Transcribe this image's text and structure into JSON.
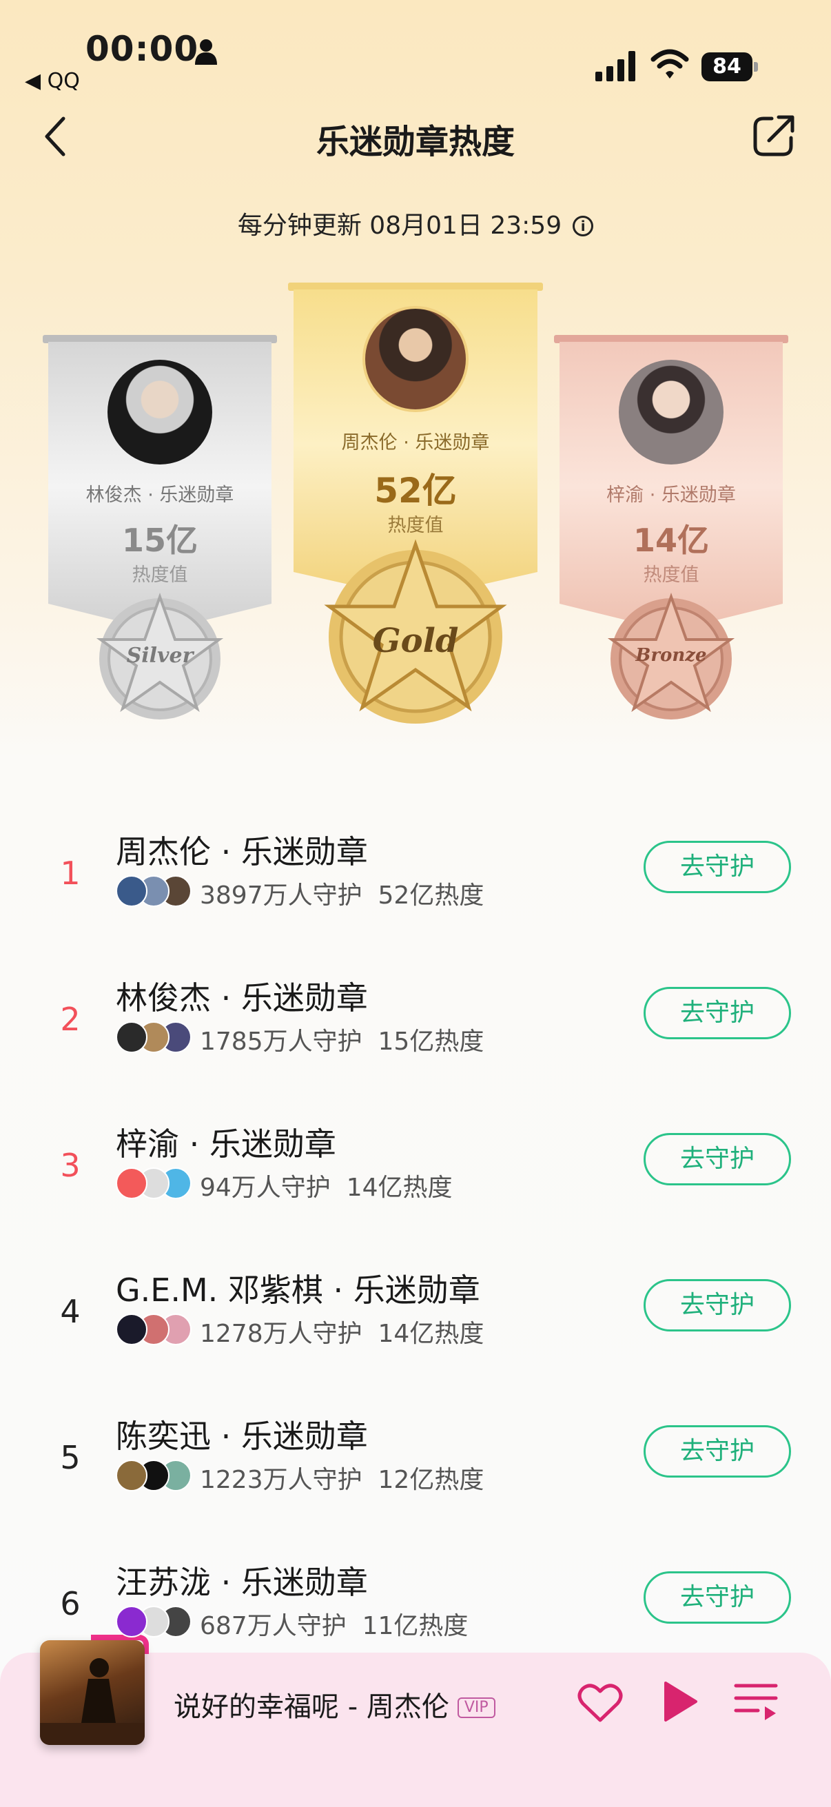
{
  "status_bar": {
    "time": "00:00",
    "back_app": "◀ QQ",
    "battery": "84"
  },
  "nav": {
    "title": "乐迷勋章热度"
  },
  "update": {
    "text": "每分钟更新 08月01日 23:59",
    "info_glyph": "i"
  },
  "podium": {
    "gold": {
      "name": "周杰伦 · 乐迷勋章",
      "value": "52亿",
      "sub": "热度值",
      "medal": "Gold"
    },
    "silver": {
      "name": "林俊杰 · 乐迷勋章",
      "value": "15亿",
      "sub": "热度值",
      "medal": "Silver"
    },
    "bronze": {
      "name": "梓渝 · 乐迷勋章",
      "value": "14亿",
      "sub": "热度值",
      "medal": "Bronze"
    }
  },
  "rankings": [
    {
      "rank": "1",
      "title": "周杰伦 · 乐迷勋章",
      "stats": "3897万人守护  52亿热度",
      "button": "去守护",
      "avatar_colors": [
        "#3a5a8a",
        "#7a8fb0",
        "#5a4636"
      ]
    },
    {
      "rank": "2",
      "title": "林俊杰 · 乐迷勋章",
      "stats": "1785万人守护  15亿热度",
      "button": "去守护",
      "avatar_colors": [
        "#2a2a2a",
        "#b08a5a",
        "#4a4a7a"
      ]
    },
    {
      "rank": "3",
      "title": "梓渝 · 乐迷勋章",
      "stats": "94万人守护  14亿热度",
      "button": "去守护",
      "avatar_colors": [
        "#f35a5a",
        "#ddd",
        "#4fb6e6"
      ]
    },
    {
      "rank": "4",
      "title": "G.E.M. 邓紫棋 · 乐迷勋章",
      "stats": "1278万人守护  14亿热度",
      "button": "去守护",
      "avatar_colors": [
        "#1a1a2a",
        "#d07070",
        "#e0a0b0"
      ]
    },
    {
      "rank": "5",
      "title": "陈奕迅 · 乐迷勋章",
      "stats": "1223万人守护  12亿热度",
      "button": "去守护",
      "avatar_colors": [
        "#8a6a3a",
        "#111",
        "#7ab0a0"
      ]
    },
    {
      "rank": "6",
      "title": "汪苏泷 · 乐迷勋章",
      "stats": "687万人守护  11亿热度",
      "button": "去守护",
      "avatar_colors": [
        "#8a2ad0",
        "#ddd",
        "#444"
      ]
    }
  ],
  "player": {
    "song": "说好的幸福呢 - 周杰伦",
    "vip": "VIP"
  },
  "colors": {
    "accent_green": "#2bc48a",
    "rank_top": "#f2505a",
    "player_bg": "#fbe4ee",
    "play_pink": "#d8246e"
  }
}
